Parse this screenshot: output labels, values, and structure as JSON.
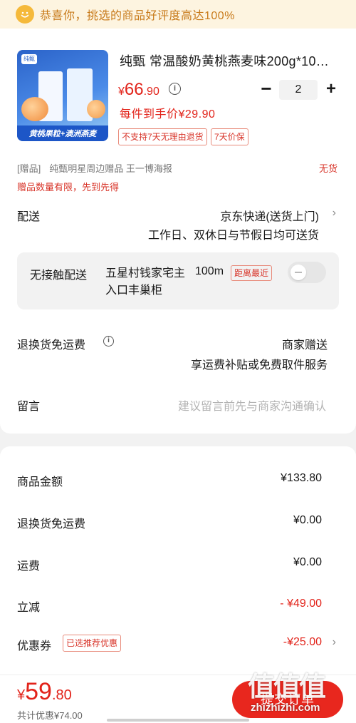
{
  "banner": {
    "text": "恭喜你，挑选的商品好评度高达100%"
  },
  "product": {
    "title": "纯甄 常温酸奶黄桃燕麦味200g*10…",
    "image_strip": "黄桃果粒+澳洲燕麦",
    "image_logo": "纯甄",
    "price_currency": "¥",
    "price_int": "66",
    "price_dec": ".90",
    "quantity": "2",
    "unit_price": "每件到手价¥29.90",
    "tags": [
      "不支持7天无理由退货",
      "7天价保"
    ]
  },
  "gift": {
    "prefix": "[赠品]",
    "name": "纯甄明星周边赠品 王一博海报",
    "status": "无货",
    "note": "赠品数量有限，先到先得"
  },
  "delivery": {
    "label": "配送",
    "value": "京东快递(送货上门)",
    "sub": "工作日、双休日与节假日均可送货"
  },
  "contactless": {
    "label": "无接触配送",
    "address": "五星村钱家宅主入口丰巢柜",
    "distance": "100m",
    "badge": "距离最近"
  },
  "return_shipping": {
    "label": "退换货免运费",
    "value": "商家赠送",
    "sub": "享运费补贴或免费取件服务"
  },
  "memo": {
    "label": "留言",
    "placeholder": "建议留言前先与商家沟通确认"
  },
  "summary": {
    "rows": [
      {
        "label": "商品金额",
        "value": "¥133.80"
      },
      {
        "label": "退换货免运费",
        "value": "¥0.00"
      },
      {
        "label": "运费",
        "value": "¥0.00"
      },
      {
        "label": "立减",
        "value": "- ¥49.00"
      },
      {
        "label": "优惠券",
        "value": "-¥25.00"
      }
    ],
    "coupon_tag": "已选推荐优惠"
  },
  "footer": {
    "total_currency": "¥",
    "total_int": "59",
    "total_dec": ".80",
    "saved": "共计优惠¥74.00",
    "submit_label": "提交订单"
  },
  "watermark": {
    "chars": "值值值",
    "url": "zhizhizhi.com"
  },
  "colors": {
    "accent": "#e2231a",
    "banner_bg": "#fdf4e0",
    "banner_text": "#c87a1a"
  }
}
